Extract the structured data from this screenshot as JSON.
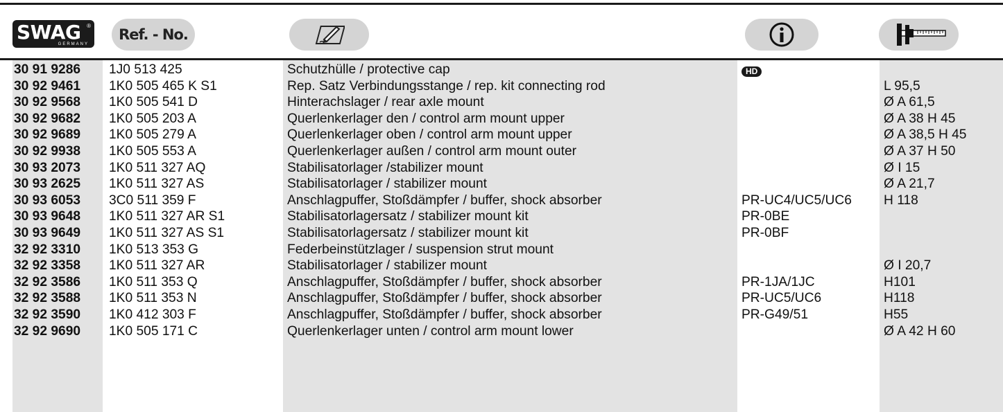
{
  "header": {
    "logo_text": "SWAG",
    "logo_sub": "GERMANY",
    "ref_label": "Ref. - No.",
    "icons": [
      "pen-writing-icon",
      "info-icon",
      "caliper-icon"
    ]
  },
  "rows": [
    {
      "article": "30 91 9286",
      "ref": "1J0 513 425",
      "desc": "Schutzhülle / protective cap",
      "info": "",
      "badge": "HD",
      "dim": ""
    },
    {
      "article": "30 92 9461",
      "ref": "1K0 505 465 K S1",
      "desc": "Rep. Satz Verbindungsstange / rep. kit connecting rod",
      "info": "",
      "badge": "",
      "dim": "L 95,5"
    },
    {
      "article": "30 92 9568",
      "ref": "1K0 505 541 D",
      "desc": "Hinterachslager / rear axle mount",
      "info": "",
      "badge": "",
      "dim": "Ø A 61,5"
    },
    {
      "article": "30 92 9682",
      "ref": "1K0 505 203 A",
      "desc": "Querlenkerlager den / control arm mount upper",
      "info": "",
      "badge": "",
      "dim": "Ø A 38 H 45"
    },
    {
      "article": "30 92 9689",
      "ref": "1K0 505 279 A",
      "desc": "Querlenkerlager oben / control arm mount upper",
      "info": "",
      "badge": "",
      "dim": "Ø A 38,5 H 45"
    },
    {
      "article": "30 92 9938",
      "ref": "1K0 505 553 A",
      "desc": "Querlenkerlager außen / control arm mount outer",
      "info": "",
      "badge": "",
      "dim": "Ø A 37 H 50"
    },
    {
      "article": "30 93 2073",
      "ref": "1K0 511 327 AQ",
      "desc": "Stabilisatorlager /stabilizer mount",
      "info": "",
      "badge": "",
      "dim": "Ø I 15"
    },
    {
      "article": "30 93 2625",
      "ref": "1K0 511 327 AS",
      "desc": "Stabilisatorlager / stabilizer mount",
      "info": "",
      "badge": "",
      "dim": "Ø A 21,7"
    },
    {
      "article": "30 93 6053",
      "ref": "3C0 511 359 F",
      "desc": "Anschlagpuffer, Stoßdämpfer / buffer, shock absorber",
      "info": "PR-UC4/UC5/UC6",
      "badge": "",
      "dim": "H 118"
    },
    {
      "article": "30 93 9648",
      "ref": "1K0 511 327 AR S1",
      "desc": "Stabilisatorlagersatz / stabilizer mount kit",
      "info": "PR-0BE",
      "badge": "",
      "dim": ""
    },
    {
      "article": "30 93 9649",
      "ref": "1K0 511 327 AS S1",
      "desc": "Stabilisatorlagersatz / stabilizer mount kit",
      "info": "PR-0BF",
      "badge": "",
      "dim": ""
    },
    {
      "article": "32 92 3310",
      "ref": "1K0 513 353 G",
      "desc": "Federbeinstützlager / suspension strut mount",
      "info": "",
      "badge": "",
      "dim": ""
    },
    {
      "article": "32 92 3358",
      "ref": "1K0 511 327 AR",
      "desc": "Stabilisatorlager / stabilizer mount",
      "info": "",
      "badge": "",
      "dim": "Ø I 20,7"
    },
    {
      "article": "32 92 3586",
      "ref": "1K0 511 353 Q",
      "desc": "Anschlagpuffer, Stoßdämpfer / buffer, shock absorber",
      "info": "PR-1JA/1JC",
      "badge": "",
      "dim": "H101"
    },
    {
      "article": "32 92 3588",
      "ref": "1K0 511 353 N",
      "desc": "Anschlagpuffer, Stoßdämpfer / buffer, shock absorber",
      "info": "PR-UC5/UC6",
      "badge": "",
      "dim": "H118"
    },
    {
      "article": "32 92 3590",
      "ref": "1K0 412 303 F",
      "desc": "Anschlagpuffer, Stoßdämpfer / buffer, shock absorber",
      "info": "PR-G49/51",
      "badge": "",
      "dim": "H55"
    },
    {
      "article": "32 92 9690",
      "ref": "1K0 505 171 C",
      "desc": "Querlenkerlager unten / control arm mount lower",
      "info": "",
      "badge": "",
      "dim": "Ø A 42 H 60"
    }
  ]
}
